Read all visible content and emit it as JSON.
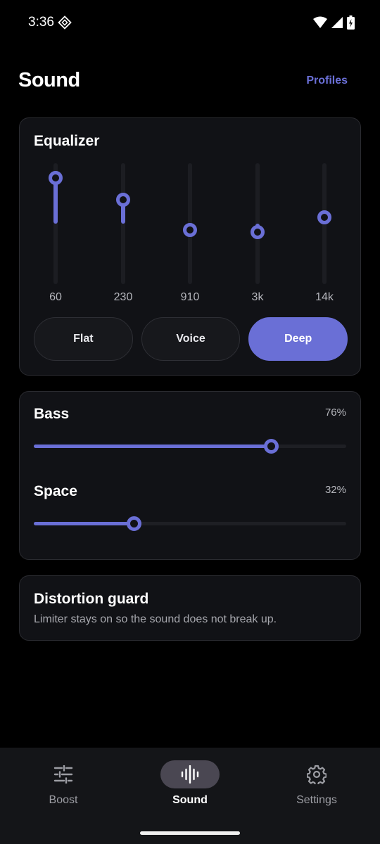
{
  "status_bar": {
    "time": "3:36"
  },
  "header": {
    "title": "Sound",
    "profiles_label": "Profiles"
  },
  "equalizer": {
    "title": "Equalizer",
    "bands": [
      {
        "label": "60",
        "level": 0.88
      },
      {
        "label": "230",
        "level": 0.7
      },
      {
        "label": "910",
        "level": 0.45
      },
      {
        "label": "3k",
        "level": 0.43
      },
      {
        "label": "14k",
        "level": 0.55
      }
    ],
    "presets": [
      {
        "label": "Flat",
        "active": false
      },
      {
        "label": "Voice",
        "active": false
      },
      {
        "label": "Deep",
        "active": true
      }
    ]
  },
  "sliders": [
    {
      "label": "Bass",
      "value_text": "76%",
      "value": 0.76
    },
    {
      "label": "Space",
      "value_text": "32%",
      "value": 0.32
    }
  ],
  "distortion_guard": {
    "title": "Distortion guard",
    "subtitle": "Limiter stays on so the sound does not break up."
  },
  "nav": {
    "items": [
      {
        "label": "Boost",
        "icon": "sliders-icon",
        "active": false
      },
      {
        "label": "Sound",
        "icon": "waveform-icon",
        "active": true
      },
      {
        "label": "Settings",
        "icon": "gear-icon",
        "active": false
      }
    ]
  },
  "colors": {
    "accent": "#6a6fd6",
    "background": "#000000",
    "card": "#111216"
  }
}
